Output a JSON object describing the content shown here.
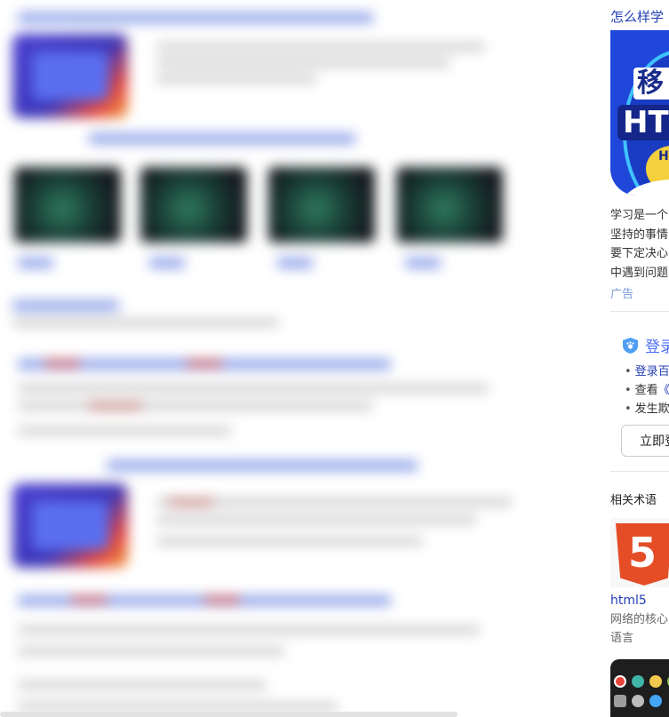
{
  "sidebar": {
    "ad": {
      "title": "怎么样学",
      "image_text_1": "移",
      "image_text_2": "HTI",
      "image_text_3": "HT",
      "text_lines": [
        "学习是一个",
        "坚持的事情",
        "要下定决心",
        "中遇到问题"
      ],
      "label": "广告"
    },
    "login": {
      "heading": "登录",
      "items": [
        {
          "prefix": "登录百",
          "highlight": ""
        },
        {
          "prefix": "查看",
          "highlight": "《"
        },
        {
          "prefix": "发生欺",
          "highlight": ""
        }
      ],
      "button_label": "立即登"
    },
    "related_terms": {
      "heading": "相关术语",
      "items": [
        {
          "logo_text": "5",
          "name": "html5",
          "desc_lines": [
            "网络的核心",
            "语言"
          ]
        }
      ]
    }
  },
  "colors": {
    "link": "#2440b3",
    "accent": "#4e6ef2",
    "ad_label": "#7d9dd3",
    "html5": "#e44d26"
  }
}
